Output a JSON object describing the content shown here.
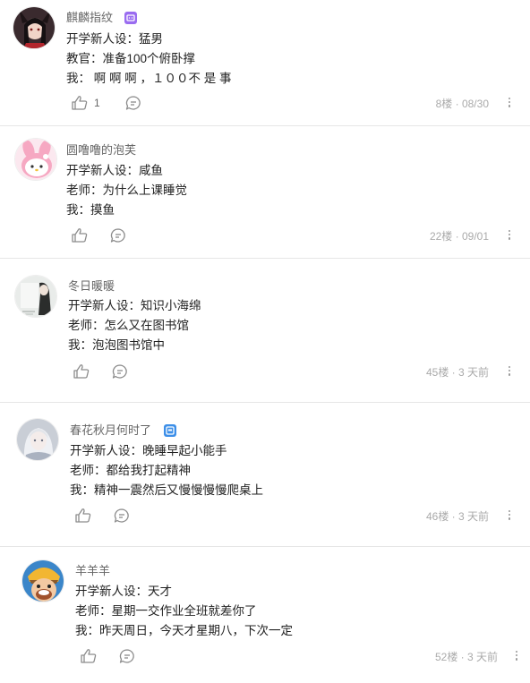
{
  "comments": [
    {
      "username": "麒麟指纹",
      "has_badge": true,
      "lines": [
        "开学新人设：猛男",
        "教官：准备100个俯卧撑",
        "我：  啊 啊 啊 ，１００不 是 事"
      ],
      "like_count": "1",
      "meta": "8楼 · 08/30"
    },
    {
      "username": "圆噜噜的泡芙",
      "has_badge": false,
      "lines": [
        "开学新人设：咸鱼",
        "老师：为什么上课睡觉",
        "我：摸鱼"
      ],
      "like_count": "",
      "meta": "22楼 · 09/01"
    },
    {
      "username": "冬日暖暖",
      "has_badge": false,
      "lines": [
        "开学新人设：知识小海绵",
        "老师：怎么又在图书馆",
        "我：泡泡图书馆中"
      ],
      "like_count": "",
      "meta": "45楼 · 3 天前"
    },
    {
      "username": "春花秋月何时了",
      "has_badge": true,
      "lines": [
        "开学新人设：晚睡早起小能手",
        "老师：都给我打起精神",
        "我：精神一震然后又慢慢慢慢爬桌上"
      ],
      "like_count": "",
      "meta": "46楼 · 3 天前"
    },
    {
      "username": "羊羊羊",
      "has_badge": false,
      "lines": [
        "开学新人设：天才",
        "老师：星期一交作业全班就差你了",
        "我：昨天周日，今天才星期八，下次一定"
      ],
      "like_count": "",
      "meta": "52楼 · 3 天前"
    }
  ],
  "icons": {
    "like": "thumbs-up-icon",
    "reply": "chat-bubble-icon",
    "more": "more-vertical-icon",
    "badge_colors": [
      "#9a6cf0",
      "#3d8fe8"
    ]
  }
}
